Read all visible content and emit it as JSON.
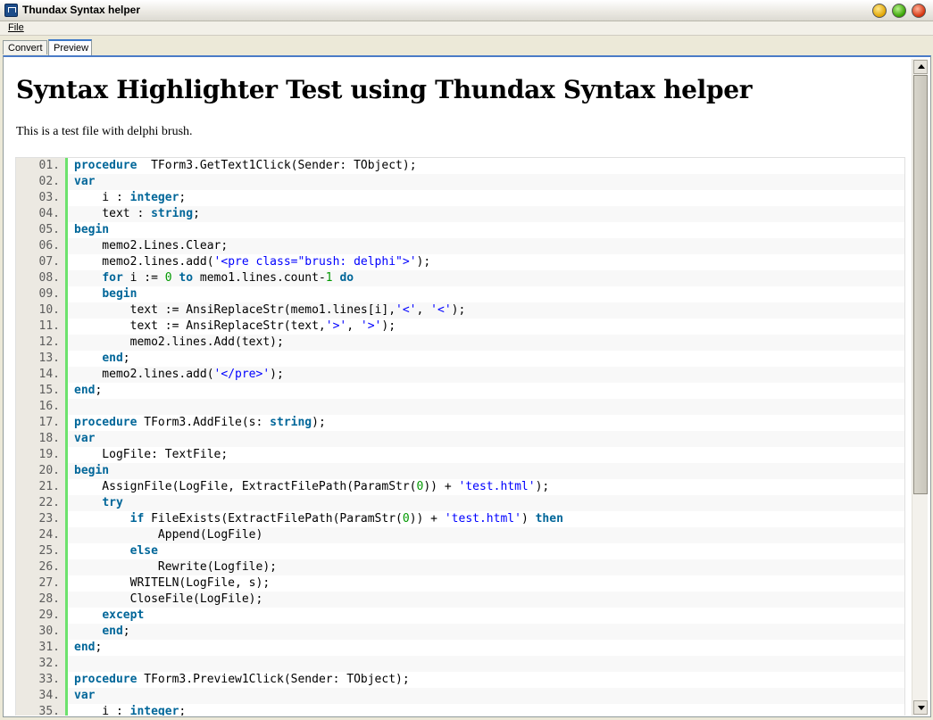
{
  "window": {
    "title": "Thundax Syntax helper"
  },
  "menu": {
    "file": "File"
  },
  "tabs": [
    {
      "label": "Convert"
    },
    {
      "label": "Preview"
    }
  ],
  "page": {
    "heading": "Syntax Highlighter Test using Thundax Syntax helper",
    "intro": "This is a test file with delphi brush."
  },
  "colors": {
    "keyword": "#006699",
    "string": "#0000ff",
    "number": "#009900",
    "gutter_accent": "#6ce26c"
  },
  "code_lines": [
    {
      "n": "01.",
      "t": [
        [
          "kw",
          "procedure"
        ],
        [
          "",
          "  TForm3.GetText1Click(Sender: TObject);"
        ]
      ]
    },
    {
      "n": "02.",
      "t": [
        [
          "kw",
          "var"
        ]
      ]
    },
    {
      "n": "03.",
      "t": [
        [
          "",
          "    i : "
        ],
        [
          "kw",
          "integer"
        ],
        [
          "",
          ";"
        ]
      ]
    },
    {
      "n": "04.",
      "t": [
        [
          "",
          "    text : "
        ],
        [
          "kw",
          "string"
        ],
        [
          "",
          ";"
        ]
      ]
    },
    {
      "n": "05.",
      "t": [
        [
          "kw",
          "begin"
        ]
      ]
    },
    {
      "n": "06.",
      "t": [
        [
          "",
          "    memo2.Lines.Clear;"
        ]
      ]
    },
    {
      "n": "07.",
      "t": [
        [
          "",
          "    memo2.lines.add("
        ],
        [
          "str",
          "'<pre class=\"brush: delphi\">'"
        ],
        [
          "",
          ");"
        ]
      ]
    },
    {
      "n": "08.",
      "t": [
        [
          "",
          "    "
        ],
        [
          "kw",
          "for"
        ],
        [
          "",
          " i := "
        ],
        [
          "num",
          "0"
        ],
        [
          "",
          " "
        ],
        [
          "kw",
          "to"
        ],
        [
          "",
          " memo1.lines.count-"
        ],
        [
          "num",
          "1"
        ],
        [
          "",
          " "
        ],
        [
          "kw",
          "do"
        ]
      ]
    },
    {
      "n": "09.",
      "t": [
        [
          "",
          "    "
        ],
        [
          "kw",
          "begin"
        ]
      ]
    },
    {
      "n": "10.",
      "t": [
        [
          "",
          "        text := AnsiReplaceStr(memo1.lines[i],"
        ],
        [
          "str",
          "'<'"
        ],
        [
          "",
          ", "
        ],
        [
          "str",
          "'<'"
        ],
        [
          "",
          ");"
        ]
      ]
    },
    {
      "n": "11.",
      "t": [
        [
          "",
          "        text := AnsiReplaceStr(text,"
        ],
        [
          "str",
          "'>'"
        ],
        [
          "",
          ", "
        ],
        [
          "str",
          "'>'"
        ],
        [
          "",
          ");"
        ]
      ]
    },
    {
      "n": "12.",
      "t": [
        [
          "",
          "        memo2.lines.Add(text);"
        ]
      ]
    },
    {
      "n": "13.",
      "t": [
        [
          "",
          "    "
        ],
        [
          "kw",
          "end"
        ],
        [
          "",
          ";"
        ]
      ]
    },
    {
      "n": "14.",
      "t": [
        [
          "",
          "    memo2.lines.add("
        ],
        [
          "str",
          "'</pre>'"
        ],
        [
          "",
          ");"
        ]
      ]
    },
    {
      "n": "15.",
      "t": [
        [
          "kw",
          "end"
        ],
        [
          "",
          ";"
        ]
      ]
    },
    {
      "n": "16.",
      "t": []
    },
    {
      "n": "17.",
      "t": [
        [
          "kw",
          "procedure"
        ],
        [
          "",
          " TForm3.AddFile(s: "
        ],
        [
          "kw",
          "string"
        ],
        [
          "",
          ");"
        ]
      ]
    },
    {
      "n": "18.",
      "t": [
        [
          "kw",
          "var"
        ]
      ]
    },
    {
      "n": "19.",
      "t": [
        [
          "",
          "    LogFile: TextFile;"
        ]
      ]
    },
    {
      "n": "20.",
      "t": [
        [
          "kw",
          "begin"
        ]
      ]
    },
    {
      "n": "21.",
      "t": [
        [
          "",
          "    AssignFile(LogFile, ExtractFilePath(ParamStr("
        ],
        [
          "num",
          "0"
        ],
        [
          "",
          "))"
        ],
        [
          "",
          " + "
        ],
        [
          "str",
          "'test.html'"
        ],
        [
          "",
          ");"
        ]
      ]
    },
    {
      "n": "22.",
      "t": [
        [
          "",
          "    "
        ],
        [
          "kw",
          "try"
        ]
      ]
    },
    {
      "n": "23.",
      "t": [
        [
          "",
          "        "
        ],
        [
          "kw",
          "if"
        ],
        [
          "",
          " FileExists(ExtractFilePath(ParamStr("
        ],
        [
          "num",
          "0"
        ],
        [
          "",
          ")) + "
        ],
        [
          "str",
          "'test.html'"
        ],
        [
          "",
          ") "
        ],
        [
          "kw",
          "then"
        ]
      ]
    },
    {
      "n": "24.",
      "t": [
        [
          "",
          "            Append(LogFile)"
        ]
      ]
    },
    {
      "n": "25.",
      "t": [
        [
          "",
          "        "
        ],
        [
          "kw",
          "else"
        ]
      ]
    },
    {
      "n": "26.",
      "t": [
        [
          "",
          "            Rewrite(Logfile);"
        ]
      ]
    },
    {
      "n": "27.",
      "t": [
        [
          "",
          "        WRITELN(LogFile, s);"
        ]
      ]
    },
    {
      "n": "28.",
      "t": [
        [
          "",
          "        CloseFile(LogFile);"
        ]
      ]
    },
    {
      "n": "29.",
      "t": [
        [
          "",
          "    "
        ],
        [
          "kw",
          "except"
        ]
      ]
    },
    {
      "n": "30.",
      "t": [
        [
          "",
          "    "
        ],
        [
          "kw",
          "end"
        ],
        [
          "",
          ";"
        ]
      ]
    },
    {
      "n": "31.",
      "t": [
        [
          "kw",
          "end"
        ],
        [
          "",
          ";"
        ]
      ]
    },
    {
      "n": "32.",
      "t": []
    },
    {
      "n": "33.",
      "t": [
        [
          "kw",
          "procedure"
        ],
        [
          "",
          " TForm3.Preview1Click(Sender: TObject);"
        ]
      ]
    },
    {
      "n": "34.",
      "t": [
        [
          "kw",
          "var"
        ]
      ]
    },
    {
      "n": "35.",
      "t": [
        [
          "",
          "    i : "
        ],
        [
          "kw",
          "integer"
        ],
        [
          "",
          ";"
        ]
      ]
    }
  ]
}
